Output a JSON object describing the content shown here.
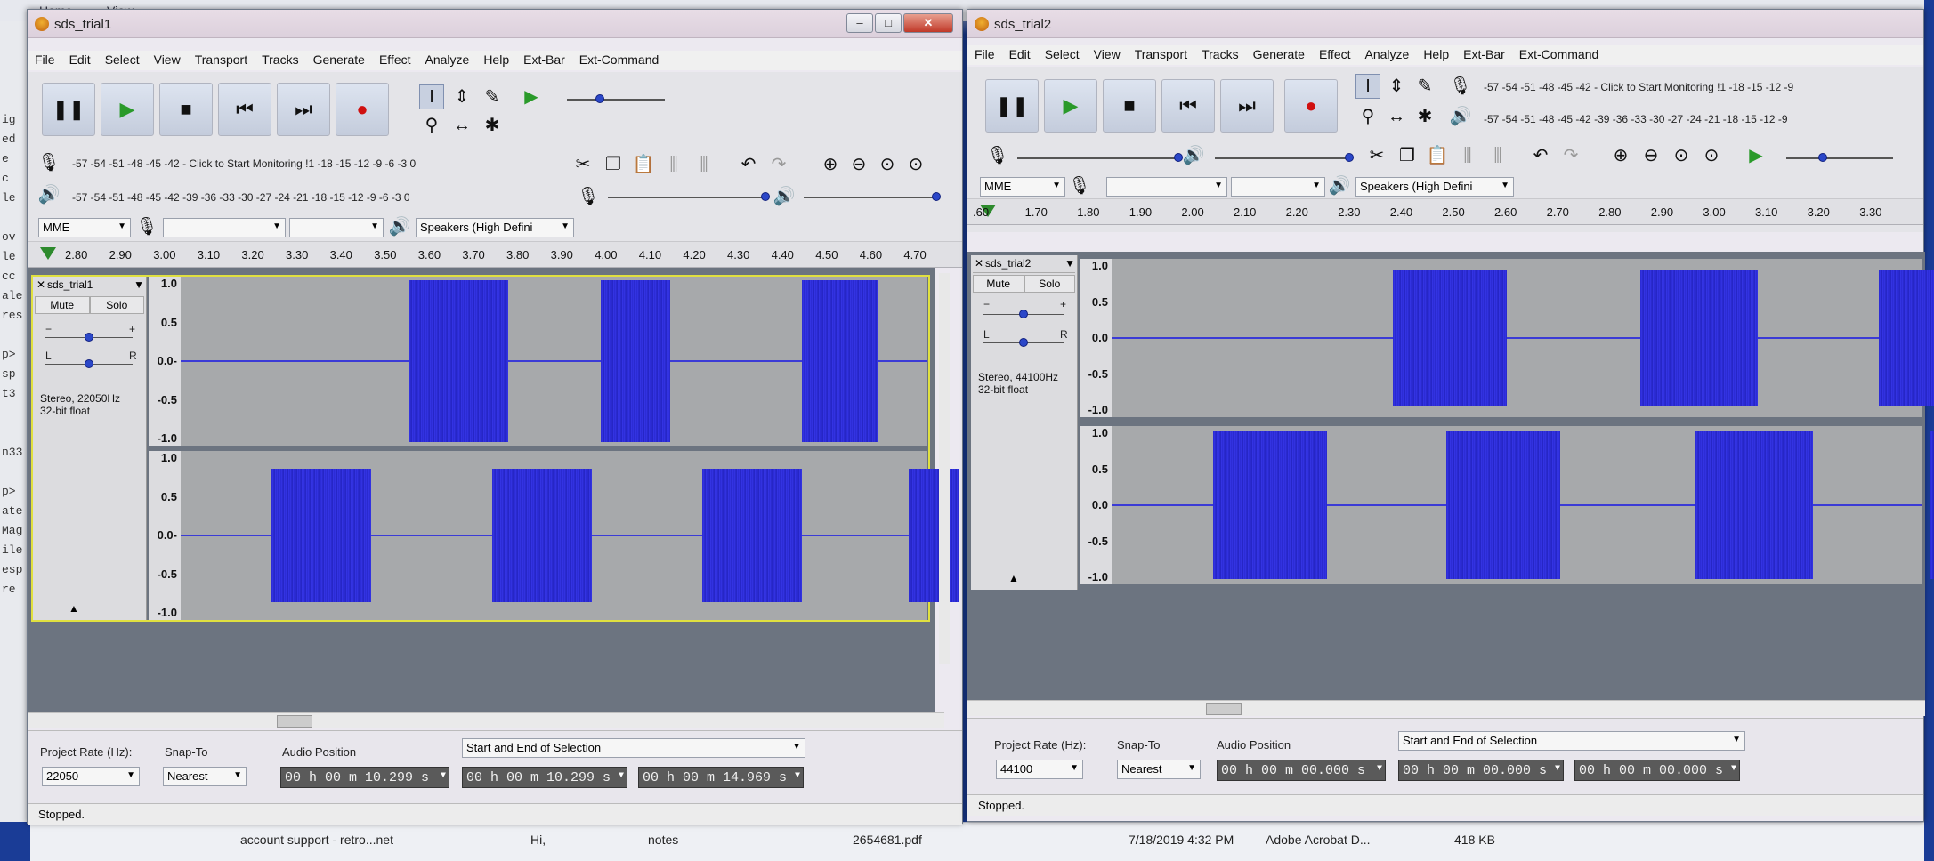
{
  "background": {
    "tabs": [
      "Home",
      "View"
    ],
    "left_code": [
      "ig",
      "ed",
      "e",
      "c",
      "le",
      "",
      "ov",
      "le",
      "cc",
      "ale",
      "res",
      "",
      "p>",
      "sp",
      "t3",
      "",
      "",
      "n33",
      "",
      "p>",
      "ate",
      "Mag",
      "ile",
      "esp",
      "re"
    ],
    "files": [
      {
        "name": "account support - retro...net"
      },
      {
        "name": "Hi,"
      },
      {
        "name": "notes"
      },
      {
        "name": "2654681.pdf"
      },
      {
        "name": "7/18/2019 4:32 PM"
      },
      {
        "name": "Adobe Acrobat D..."
      },
      {
        "name": "418 KB"
      }
    ]
  },
  "window1": {
    "title": "sds_trial1",
    "menu": [
      "File",
      "Edit",
      "Select",
      "View",
      "Transport",
      "Tracks",
      "Generate",
      "Effect",
      "Analyze",
      "Help",
      "Ext-Bar",
      "Ext-Command"
    ],
    "rec_meter": "-57 -54 -51 -48 -45 -42 -  Click to Start Monitoring !1 -18 -15 -12  -9  -6  -3  0",
    "play_meter": "-57 -54 -51 -48 -45 -42 -39 -36 -33 -30 -27 -24 -21 -18 -15 -12  -9  -6  -3  0",
    "host": "MME",
    "output_device": "Speakers (High Defini",
    "ruler": [
      "2.80",
      "2.90",
      "3.00",
      "3.10",
      "3.20",
      "3.30",
      "3.40",
      "3.50",
      "3.60",
      "3.70",
      "3.80",
      "3.90",
      "4.00",
      "4.10",
      "4.20",
      "4.30",
      "4.40",
      "4.50",
      "4.60",
      "4.70"
    ],
    "track": {
      "name": "sds_trial1",
      "mute": "Mute",
      "solo": "Solo",
      "info1": "Stereo, 22050Hz",
      "info2": "32-bit float"
    },
    "yaxis": [
      "1.0",
      "0.5",
      "0.0-",
      "-0.5",
      "-1.0"
    ],
    "project_rate_label": "Project Rate (Hz):",
    "project_rate": "22050",
    "snap_label": "Snap-To",
    "snap": "Nearest",
    "audio_pos_label": "Audio Position",
    "audio_pos": "00 h 00 m 10.299 s",
    "selection_label": "Start and End of Selection",
    "sel_start": "00 h 00 m 10.299 s",
    "sel_end": "00 h 00 m 14.969 s",
    "status": "Stopped."
  },
  "window2": {
    "title": "sds_trial2",
    "menu": [
      "File",
      "Edit",
      "Select",
      "View",
      "Transport",
      "Tracks",
      "Generate",
      "Effect",
      "Analyze",
      "Help",
      "Ext-Bar",
      "Ext-Command"
    ],
    "rec_meter": "-57 -54 -51 -48 -45 -42 -  Click to Start Monitoring !1 -18 -15 -12  -9",
    "play_meter": "-57 -54 -51 -48 -45 -42 -39 -36 -33 -30 -27 -24 -21 -18 -15 -12  -9",
    "host": "MME",
    "output_device": "Speakers (High Defini",
    "ruler": [
      ".60",
      "1.70",
      "1.80",
      "1.90",
      "2.00",
      "2.10",
      "2.20",
      "2.30",
      "2.40",
      "2.50",
      "2.60",
      "2.70",
      "2.80",
      "2.90",
      "3.00",
      "3.10",
      "3.20",
      "3.30"
    ],
    "track": {
      "name": "sds_trial2",
      "mute": "Mute",
      "solo": "Solo",
      "info1": "Stereo, 44100Hz",
      "info2": "32-bit float"
    },
    "yaxis": [
      "1.0",
      "0.5",
      "0.0",
      "-0.5",
      "-1.0"
    ],
    "project_rate_label": "Project Rate (Hz):",
    "project_rate": "44100",
    "snap_label": "Snap-To",
    "snap": "Nearest",
    "audio_pos_label": "Audio Position",
    "audio_pos": "00 h 00 m 00.000 s",
    "selection_label": "Start and End of Selection",
    "sel_start": "00 h 00 m 00.000 s",
    "sel_end": "00 h 00 m 00.000 s",
    "status": "Stopped."
  }
}
